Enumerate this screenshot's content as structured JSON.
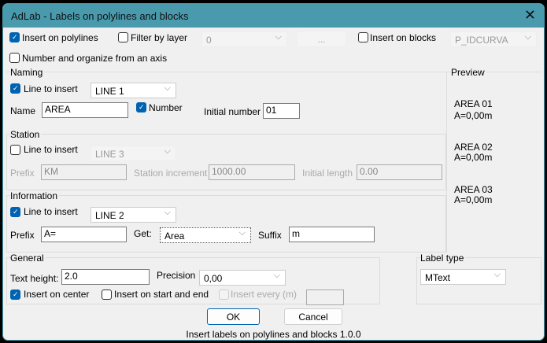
{
  "window": {
    "title": "AdLab - Labels on polylines and blocks",
    "close": "✕"
  },
  "top": {
    "insert_polylines": "Insert on polylines",
    "insert_polylines_checked": true,
    "filter_layer": "Filter by layer",
    "filter_layer_checked": false,
    "layer_value": "0",
    "browse_label": "...",
    "insert_blocks": "Insert on blocks",
    "insert_blocks_checked": false,
    "block_value": "P_IDCURVA",
    "number_axis": "Number and organize from an axis",
    "number_axis_checked": false
  },
  "naming": {
    "title": "Naming",
    "line_label": "Line to insert",
    "line_checked": true,
    "line_value": "LINE 1",
    "name_label": "Name",
    "name_value": "AREA",
    "number_label": "Number",
    "number_checked": true,
    "initial_label": "Initial number",
    "initial_value": "01"
  },
  "station": {
    "title": "Station",
    "line_label": "Line to insert",
    "line_checked": false,
    "line_value": "LINE 3",
    "prefix_label": "Prefix",
    "prefix_value": "KM",
    "increment_label": "Station increment",
    "increment_value": "1000.00",
    "initial_label": "Initial length",
    "initial_value": "0.00"
  },
  "information": {
    "title": "Information",
    "line_label": "Line to insert",
    "line_checked": true,
    "line_value": "LINE 2",
    "prefix_label": "Prefix",
    "prefix_value": "A=",
    "get_label": "Get:",
    "get_value": "Area",
    "suffix_label": "Suffix",
    "suffix_value": "m"
  },
  "preview": {
    "title": "Preview",
    "items": [
      {
        "name": "AREA 01",
        "value": "A=0,00m"
      },
      {
        "name": "AREA 02",
        "value": "A=0,00m"
      },
      {
        "name": "AREA 03",
        "value": "A=0,00m"
      }
    ]
  },
  "general": {
    "title": "General",
    "text_height_label": "Text height:",
    "text_height_value": "2.0",
    "precision_label": "Precision",
    "precision_value": "0,00",
    "center_label": "Insert on center",
    "center_checked": true,
    "start_end_label": "Insert on start and end",
    "start_end_checked": false,
    "every_label": "Insert every (m)",
    "every_value": ""
  },
  "label_type": {
    "title": "Label type",
    "value": "MText"
  },
  "buttons": {
    "ok": "OK",
    "cancel": "Cancel"
  },
  "footer": "Insert labels on polylines and blocks 1.0.0",
  "colors": {
    "titlebar": "#4a9aad",
    "accent": "#0063b1"
  }
}
